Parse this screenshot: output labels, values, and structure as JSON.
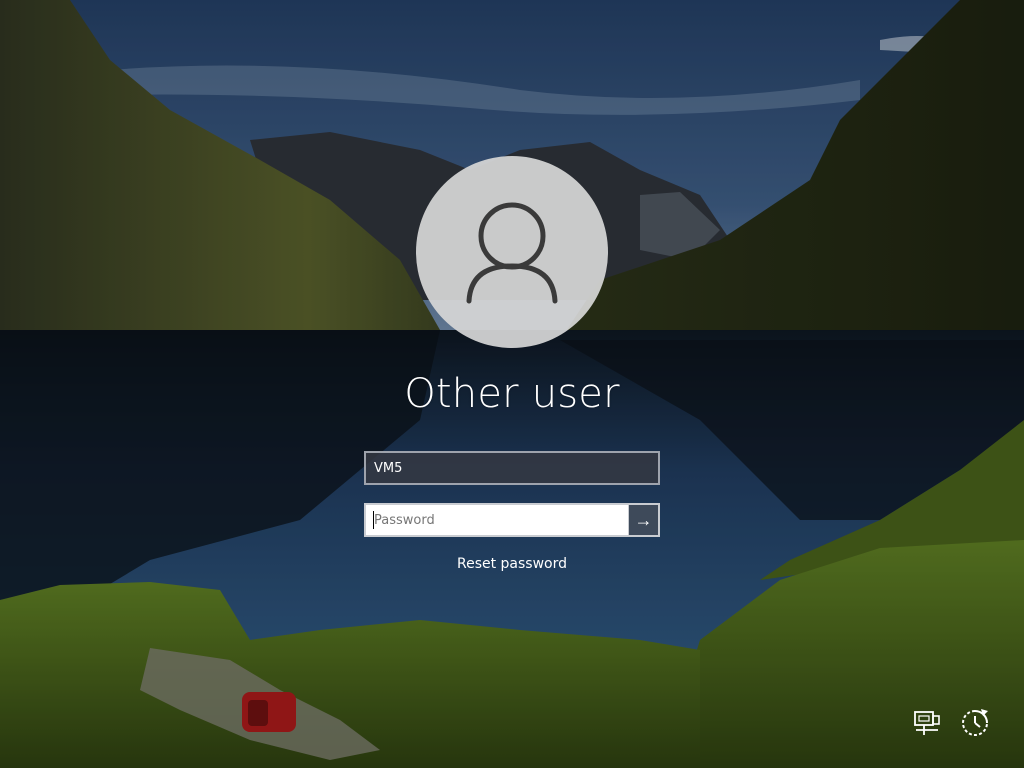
{
  "login": {
    "username": "Other user",
    "user_field_value": "VM5",
    "password_placeholder": "Password",
    "submit_icon": "arrow-right-icon",
    "submit_glyph": "→",
    "reset_label": "Reset password"
  },
  "tray": {
    "network_icon": "network-icon",
    "accessibility_icon": "ease-of-access-icon"
  },
  "colors": {
    "sky": "#2d4a6e",
    "lake": "#1f3a5c",
    "moss": "#4e6a1f",
    "avatar_bg": "#d6d6d6",
    "avatar_glyph": "#3a3a3a"
  }
}
